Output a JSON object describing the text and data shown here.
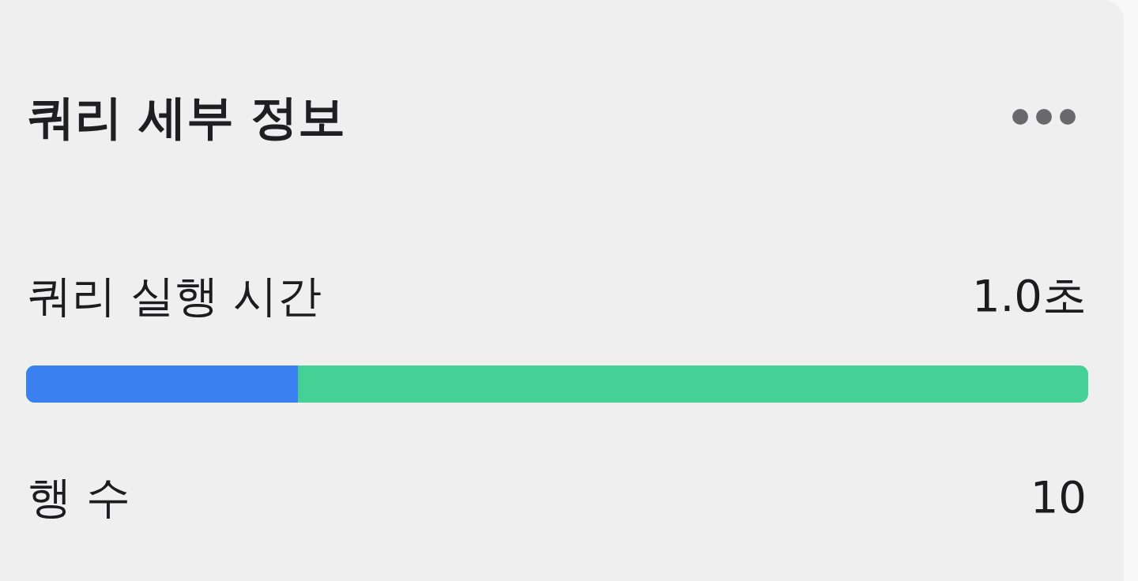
{
  "card": {
    "title": "쿼리 세부 정보"
  },
  "metrics": [
    {
      "kind": "duration",
      "label": "쿼리 실행 시간",
      "value": "1.0초",
      "level": 0.256
    },
    {
      "kind": "count",
      "label": "행 수",
      "value": "10"
    }
  ]
}
